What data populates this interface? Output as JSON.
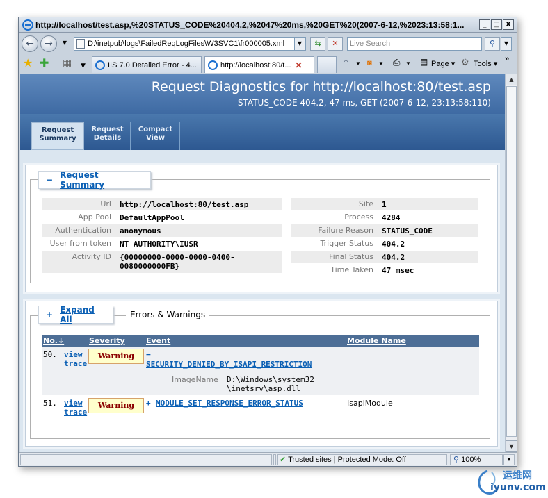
{
  "window": {
    "title": "http://localhost/test.asp,%20STATUS_CODE%20404.2,%2047%20ms,%20GET%20(2007-6-12,%2023:13:58:1...",
    "controls": {
      "minimize": "_",
      "maximize": "□",
      "close": "X"
    }
  },
  "addressbar": {
    "back": "←",
    "forward": "→",
    "url": "D:\\inetpub\\logs\\FailedReqLogFiles\\W3SVC1\\fr000005.xml",
    "search_placeholder": "Live Search"
  },
  "tabs": [
    {
      "label": "IIS 7.0 Detailed Error - 4...",
      "active": false
    },
    {
      "label": "http://localhost:80/t...",
      "active": true
    }
  ],
  "commandbar": {
    "page": "Page",
    "tools": "Tools",
    "more": "»"
  },
  "header": {
    "title_prefix": "Request Diagnostics for",
    "title_link": "http://localhost:80/test.asp",
    "subtitle": "STATUS_CODE 404.2, 47 ms, GET (2007-6-12, 23:13:58:110)"
  },
  "nav": [
    {
      "line1": "Request",
      "line2": "Summary",
      "active": true
    },
    {
      "line1": "Request",
      "line2": "Details",
      "active": false
    },
    {
      "line1": "Compact",
      "line2": "View",
      "active": false
    }
  ],
  "summary": {
    "toggle": "−",
    "heading": "Request Summary",
    "left": [
      {
        "label": "Url",
        "value": "http://localhost:80/test.asp"
      },
      {
        "label": "App Pool",
        "value": "DefaultAppPool"
      },
      {
        "label": "Authentication",
        "value": "anonymous"
      },
      {
        "label": "User from token",
        "value": "NT AUTHORITY\\IUSR"
      },
      {
        "label": "Activity ID",
        "value": "{00000000-0000-0000-0400-",
        "value2": "0080000000FB}"
      }
    ],
    "right": [
      {
        "label": "Site",
        "value": "1"
      },
      {
        "label": "Process",
        "value": "4284"
      },
      {
        "label": "Failure Reason",
        "value": "STATUS_CODE"
      },
      {
        "label": "Trigger Status",
        "value": "404.2"
      },
      {
        "label": "Final Status",
        "value": "404.2"
      },
      {
        "label": "Time Taken",
        "value": "47 msec"
      }
    ]
  },
  "errors": {
    "toggle": "+",
    "expand_all": "Expand All",
    "heading": "Errors & Warnings",
    "columns": {
      "no": "No.↓",
      "severity": "Severity",
      "event": "Event",
      "module": "Module Name"
    },
    "rows": [
      {
        "no": "50.",
        "view": "view",
        "trace": "trace",
        "severity": "Warning",
        "toggle": "−",
        "event": "SECURITY_DENIED_BY_ISAPI_RESTRICTION",
        "module": "",
        "detail_label": "ImageName",
        "detail_value_1": "D:\\Windows\\system32",
        "detail_value_2": "\\inetsrv\\asp.dll"
      },
      {
        "no": "51.",
        "view": "view",
        "trace": "trace",
        "severity": "Warning",
        "toggle": "+",
        "event": "MODULE_SET_RESPONSE_ERROR_STATUS",
        "module": "IsapiModule"
      }
    ]
  },
  "statusbar": {
    "zone": "Trusted sites | Protected Mode: Off",
    "zoom": "100%"
  },
  "watermark": {
    "line1": "运维网",
    "line2": "iyunv.com"
  }
}
